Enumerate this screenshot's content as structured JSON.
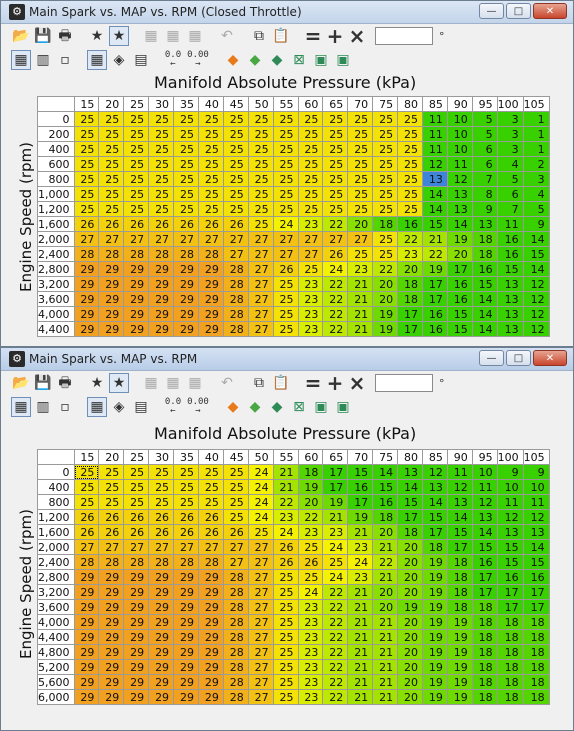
{
  "windows": [
    {
      "title": "Main Spark vs. MAP vs. RPM (Closed Throttle)",
      "active": false,
      "table": {
        "columns": [
          "15",
          "20",
          "25",
          "30",
          "35",
          "40",
          "45",
          "50",
          "55",
          "60",
          "65",
          "70",
          "75",
          "80",
          "85",
          "90",
          "95",
          "100",
          "105"
        ],
        "rows": [
          {
            "label": "0",
            "values": [
              25,
              25,
              25,
              25,
              25,
              25,
              25,
              25,
              25,
              25,
              25,
              25,
              25,
              25,
              11,
              10,
              5,
              3,
              1
            ]
          },
          {
            "label": "200",
            "values": [
              25,
              25,
              25,
              25,
              25,
              25,
              25,
              25,
              25,
              25,
              25,
              25,
              25,
              25,
              11,
              10,
              5,
              3,
              1
            ]
          },
          {
            "label": "400",
            "values": [
              25,
              25,
              25,
              25,
              25,
              25,
              25,
              25,
              25,
              25,
              25,
              25,
              25,
              25,
              11,
              10,
              6,
              3,
              1
            ]
          },
          {
            "label": "600",
            "values": [
              25,
              25,
              25,
              25,
              25,
              25,
              25,
              25,
              25,
              25,
              25,
              25,
              25,
              25,
              12,
              11,
              6,
              4,
              2
            ]
          },
          {
            "label": "800",
            "values": [
              25,
              25,
              25,
              25,
              25,
              25,
              25,
              25,
              25,
              25,
              25,
              25,
              25,
              25,
              13,
              12,
              7,
              5,
              3
            ]
          },
          {
            "label": "1,000",
            "values": [
              25,
              25,
              25,
              25,
              25,
              25,
              25,
              25,
              25,
              25,
              25,
              25,
              25,
              25,
              14,
              13,
              8,
              6,
              4
            ]
          },
          {
            "label": "1,200",
            "values": [
              25,
              25,
              25,
              25,
              25,
              25,
              25,
              25,
              25,
              25,
              25,
              25,
              25,
              25,
              14,
              13,
              9,
              7,
              5
            ]
          },
          {
            "label": "1,600",
            "values": [
              26,
              26,
              26,
              26,
              26,
              26,
              26,
              25,
              24,
              23,
              22,
              20,
              18,
              16,
              15,
              14,
              13,
              11,
              9
            ]
          },
          {
            "label": "2,000",
            "values": [
              27,
              27,
              27,
              27,
              27,
              27,
              27,
              27,
              27,
              27,
              27,
              27,
              25,
              22,
              21,
              19,
              18,
              16,
              14
            ]
          },
          {
            "label": "2,400",
            "values": [
              28,
              28,
              28,
              28,
              28,
              28,
              27,
              27,
              27,
              27,
              26,
              25,
              25,
              23,
              22,
              20,
              18,
              16,
              15
            ]
          },
          {
            "label": "2,800",
            "values": [
              29,
              29,
              29,
              29,
              29,
              29,
              28,
              27,
              26,
              25,
              24,
              23,
              22,
              20,
              19,
              17,
              16,
              15,
              14
            ]
          },
          {
            "label": "3,200",
            "values": [
              29,
              29,
              29,
              29,
              29,
              29,
              28,
              27,
              25,
              23,
              22,
              21,
              20,
              18,
              17,
              16,
              15,
              13,
              12
            ]
          },
          {
            "label": "3,600",
            "values": [
              29,
              29,
              29,
              29,
              29,
              29,
              28,
              27,
              25,
              23,
              22,
              21,
              20,
              18,
              17,
              16,
              14,
              13,
              12
            ]
          },
          {
            "label": "4,000",
            "values": [
              29,
              29,
              29,
              29,
              29,
              29,
              28,
              27,
              25,
              23,
              22,
              21,
              19,
              17,
              16,
              15,
              14,
              13,
              12
            ]
          },
          {
            "label": "4,400",
            "values": [
              29,
              29,
              29,
              29,
              29,
              29,
              28,
              27,
              25,
              23,
              22,
              21,
              19,
              17,
              16,
              15,
              14,
              13,
              12
            ]
          }
        ]
      }
    },
    {
      "title": "Main Spark vs. MAP vs. RPM",
      "active": true,
      "table": {
        "columns": [
          "15",
          "20",
          "25",
          "30",
          "35",
          "40",
          "45",
          "50",
          "55",
          "60",
          "65",
          "70",
          "75",
          "80",
          "85",
          "90",
          "95",
          "100",
          "105"
        ],
        "rows": [
          {
            "label": "0",
            "values": [
              25,
              25,
              25,
              25,
              25,
              25,
              25,
              24,
              21,
              18,
              17,
              15,
              14,
              13,
              12,
              11,
              10,
              9,
              9
            ]
          },
          {
            "label": "400",
            "values": [
              25,
              25,
              25,
              25,
              25,
              25,
              25,
              24,
              21,
              19,
              17,
              16,
              15,
              14,
              13,
              12,
              11,
              10,
              10
            ]
          },
          {
            "label": "800",
            "values": [
              25,
              25,
              25,
              25,
              25,
              25,
              25,
              24,
              22,
              20,
              19,
              17,
              16,
              15,
              14,
              13,
              12,
              11,
              11
            ]
          },
          {
            "label": "1,200",
            "values": [
              26,
              26,
              26,
              26,
              26,
              26,
              25,
              24,
              23,
              22,
              21,
              19,
              18,
              17,
              15,
              14,
              13,
              12,
              12
            ]
          },
          {
            "label": "1,600",
            "values": [
              26,
              26,
              26,
              26,
              26,
              26,
              26,
              25,
              24,
              23,
              23,
              21,
              20,
              18,
              17,
              15,
              14,
              13,
              13
            ]
          },
          {
            "label": "2,000",
            "values": [
              27,
              27,
              27,
              27,
              27,
              27,
              27,
              27,
              26,
              25,
              24,
              23,
              21,
              20,
              18,
              17,
              15,
              15,
              14
            ]
          },
          {
            "label": "2,400",
            "values": [
              28,
              28,
              28,
              28,
              28,
              28,
              27,
              27,
              26,
              26,
              25,
              24,
              22,
              20,
              19,
              18,
              16,
              15,
              15
            ]
          },
          {
            "label": "2,800",
            "values": [
              29,
              29,
              29,
              29,
              29,
              29,
              28,
              27,
              25,
              25,
              24,
              23,
              21,
              20,
              19,
              18,
              17,
              16,
              16
            ]
          },
          {
            "label": "3,200",
            "values": [
              29,
              29,
              29,
              29,
              29,
              29,
              28,
              27,
              25,
              24,
              22,
              21,
              20,
              20,
              19,
              18,
              17,
              17,
              17
            ]
          },
          {
            "label": "3,600",
            "values": [
              29,
              29,
              29,
              29,
              29,
              29,
              28,
              27,
              25,
              23,
              22,
              21,
              20,
              19,
              19,
              18,
              18,
              17,
              17
            ]
          },
          {
            "label": "4,000",
            "values": [
              29,
              29,
              29,
              29,
              29,
              29,
              28,
              27,
              25,
              23,
              22,
              21,
              21,
              20,
              19,
              19,
              18,
              18,
              18
            ]
          },
          {
            "label": "4,400",
            "values": [
              29,
              29,
              29,
              29,
              29,
              29,
              28,
              27,
              25,
              23,
              22,
              21,
              21,
              20,
              19,
              19,
              18,
              18,
              18
            ]
          },
          {
            "label": "4,800",
            "values": [
              29,
              29,
              29,
              29,
              29,
              29,
              28,
              27,
              25,
              23,
              22,
              21,
              21,
              20,
              19,
              19,
              18,
              18,
              18
            ]
          },
          {
            "label": "5,200",
            "values": [
              29,
              29,
              29,
              29,
              29,
              29,
              28,
              27,
              25,
              23,
              22,
              21,
              21,
              20,
              19,
              19,
              18,
              18,
              18
            ]
          },
          {
            "label": "5,600",
            "values": [
              29,
              29,
              29,
              29,
              29,
              29,
              28,
              27,
              25,
              23,
              22,
              21,
              21,
              20,
              19,
              19,
              18,
              18,
              18
            ]
          },
          {
            "label": "6,000",
            "values": [
              29,
              29,
              29,
              29,
              29,
              29,
              28,
              27,
              25,
              23,
              22,
              21,
              21,
              20,
              19,
              19,
              18,
              18,
              18
            ]
          }
        ]
      }
    }
  ],
  "labels": {
    "x_axis": "Manifold Absolute Pressure (kPa)",
    "y_axis": "Engine Speed (rpm)",
    "degree": "°"
  },
  "toolbar_text": {
    "btn_00_left": "0.0\n←",
    "btn_00_right": "0.00\n→"
  },
  "colors": {
    "orange": "#f2a020",
    "yellow": "#f4f200",
    "green": "#39d000",
    "highlight": "#3d85d8"
  },
  "highlight": {
    "window": 0,
    "row": 4,
    "col": 14
  },
  "cursor": {
    "window": 1,
    "row": 0,
    "col": 0
  }
}
